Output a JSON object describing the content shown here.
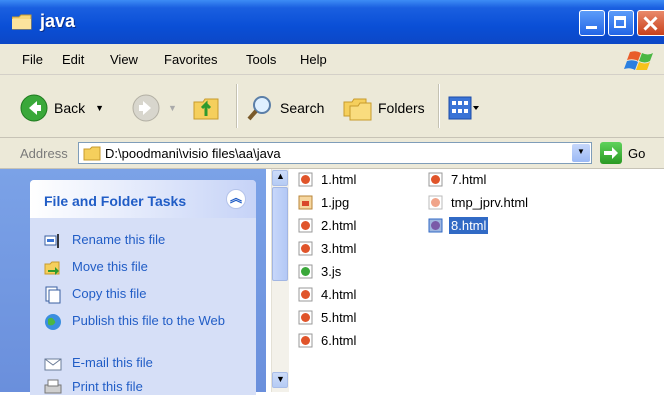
{
  "window": {
    "title": "java"
  },
  "menu": [
    "File",
    "Edit",
    "View",
    "Favorites",
    "Tools",
    "Help"
  ],
  "toolbar": {
    "back": "Back",
    "search": "Search",
    "folders": "Folders"
  },
  "address": {
    "label": "Address",
    "path": "D:\\poodmani\\visio files\\aa\\java",
    "go": "Go"
  },
  "tasks": {
    "title": "File and Folder Tasks",
    "items": [
      {
        "label": "Rename this file",
        "icon": "rename-icon"
      },
      {
        "label": "Move this file",
        "icon": "move-icon"
      },
      {
        "label": "Copy this file",
        "icon": "copy-icon"
      },
      {
        "label": "Publish this file to the Web",
        "icon": "publish-icon"
      },
      {
        "label": "E-mail this file",
        "icon": "email-icon"
      },
      {
        "label": "Print this file",
        "icon": "print-icon"
      }
    ]
  },
  "files": {
    "col1": [
      "1.html",
      "1.jpg",
      "2.html",
      "3.html",
      "3.js",
      "4.html",
      "5.html",
      "6.html"
    ],
    "col2": [
      "7.html",
      "tmp_jprv.html",
      "8.html"
    ],
    "selected": "8.html"
  }
}
